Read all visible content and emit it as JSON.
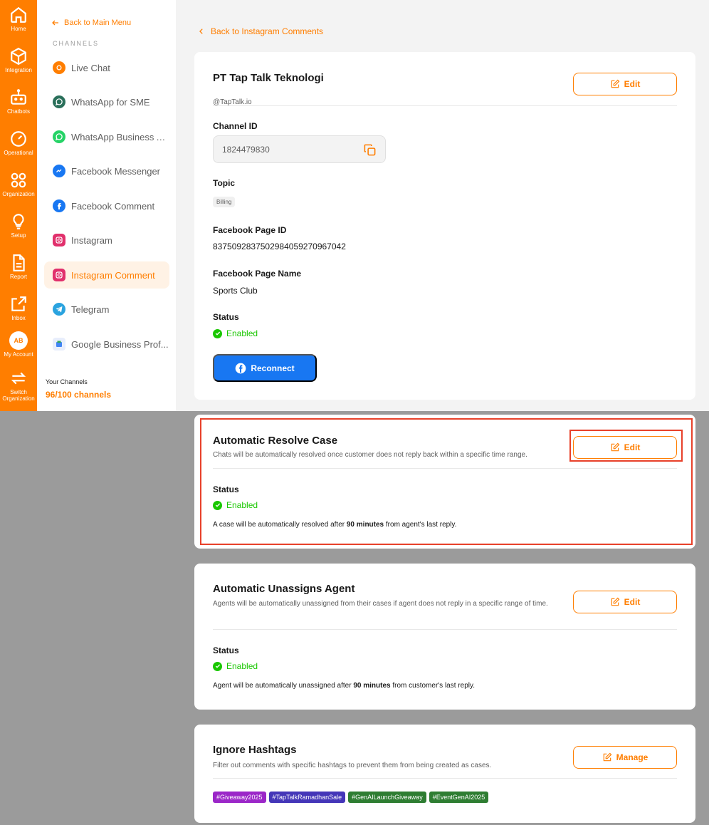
{
  "rail": [
    {
      "name": "home",
      "label": "Home"
    },
    {
      "name": "integration",
      "label": "Integration"
    },
    {
      "name": "chatbots",
      "label": "Chatbots"
    },
    {
      "name": "operational",
      "label": "Operational"
    },
    {
      "name": "organization",
      "label": "Organization"
    },
    {
      "name": "setup",
      "label": "Setup"
    },
    {
      "name": "report",
      "label": "Report"
    },
    {
      "name": "inbox",
      "label": "Inbox"
    },
    {
      "name": "my-account",
      "label": "My Account",
      "initials": "AB"
    },
    {
      "name": "switch-organization",
      "label": "Switch Organization"
    }
  ],
  "sidebar": {
    "back_label": "Back to Main Menu",
    "heading": "CHANNELS",
    "items": [
      {
        "label": "Live Chat",
        "color": "#ff7e00"
      },
      {
        "label": "WhatsApp for SME",
        "color": "#2a6f5a"
      },
      {
        "label": "WhatsApp Business API",
        "color": "#25d366"
      },
      {
        "label": "Facebook Messenger",
        "color": "#1877f2"
      },
      {
        "label": "Facebook Comment",
        "color": "#1877f2"
      },
      {
        "label": "Instagram",
        "color": "#e1306c"
      },
      {
        "label": "Instagram Comment",
        "color": "#e1306c"
      },
      {
        "label": "Telegram",
        "color": "#2aa3df"
      },
      {
        "label": "Google Business Prof...",
        "color": "#4285f4"
      }
    ],
    "your_channels_label": "Your Channels",
    "your_channels_value": "96/100 channels"
  },
  "main": {
    "back_label": "Back to Instagram Comments",
    "account_card": {
      "title": "PT Tap Talk Teknologi",
      "handle": "@TapTalk.io",
      "edit_label": "Edit",
      "channel_id_label": "Channel ID",
      "channel_id_value": "1824479830",
      "topic_label": "Topic",
      "topic_value": "Billing",
      "fb_page_id_label": "Facebook Page ID",
      "fb_page_id_value": "837509283750298405927096704 2",
      "fb_page_name_label": "Facebook Page Name",
      "fb_page_name_value": "Sports Club",
      "status_label": "Status",
      "status_value": "Enabled",
      "reconnect_label": "Reconnect"
    },
    "resolve_card": {
      "title": "Automatic Resolve Case",
      "desc": "Chats will be automatically resolved once customer does not reply back within a specific time range.",
      "edit_label": "Edit",
      "status_label": "Status",
      "status_value": "Enabled",
      "note_pre": "A case will be automatically resolved after ",
      "note_bold": "90 minutes",
      "note_post": " from agent's last reply."
    },
    "unassign_card": {
      "title": "Automatic Unassigns Agent",
      "desc": "Agents will be automatically unassigned from their cases if agent does not reply in a specific range of time.",
      "edit_label": "Edit",
      "status_label": "Status",
      "status_value": "Enabled",
      "note_pre": "Agent will be automatically unassigned after ",
      "note_bold": "90 minutes",
      "note_post": " from customer's last reply."
    },
    "hashtags_card": {
      "title": "Ignore Hashtags",
      "desc": "Filter out comments with specific hashtags to prevent them from being created as cases.",
      "manage_label": "Manage",
      "tags": [
        {
          "label": "#Giveaway2025",
          "color": "#9b27c8"
        },
        {
          "label": "#TapTalkRamadhanSale",
          "color": "#4436b8"
        },
        {
          "label": "#GenAILaunchGiveaway",
          "color": "#2e7d32"
        },
        {
          "label": "#EventGenAI2025",
          "color": "#2e7d32"
        }
      ]
    }
  },
  "colors": {
    "brand": "#ff7e00",
    "success": "#19c700",
    "highlight": "#e8412a",
    "facebook": "#1877f2"
  }
}
